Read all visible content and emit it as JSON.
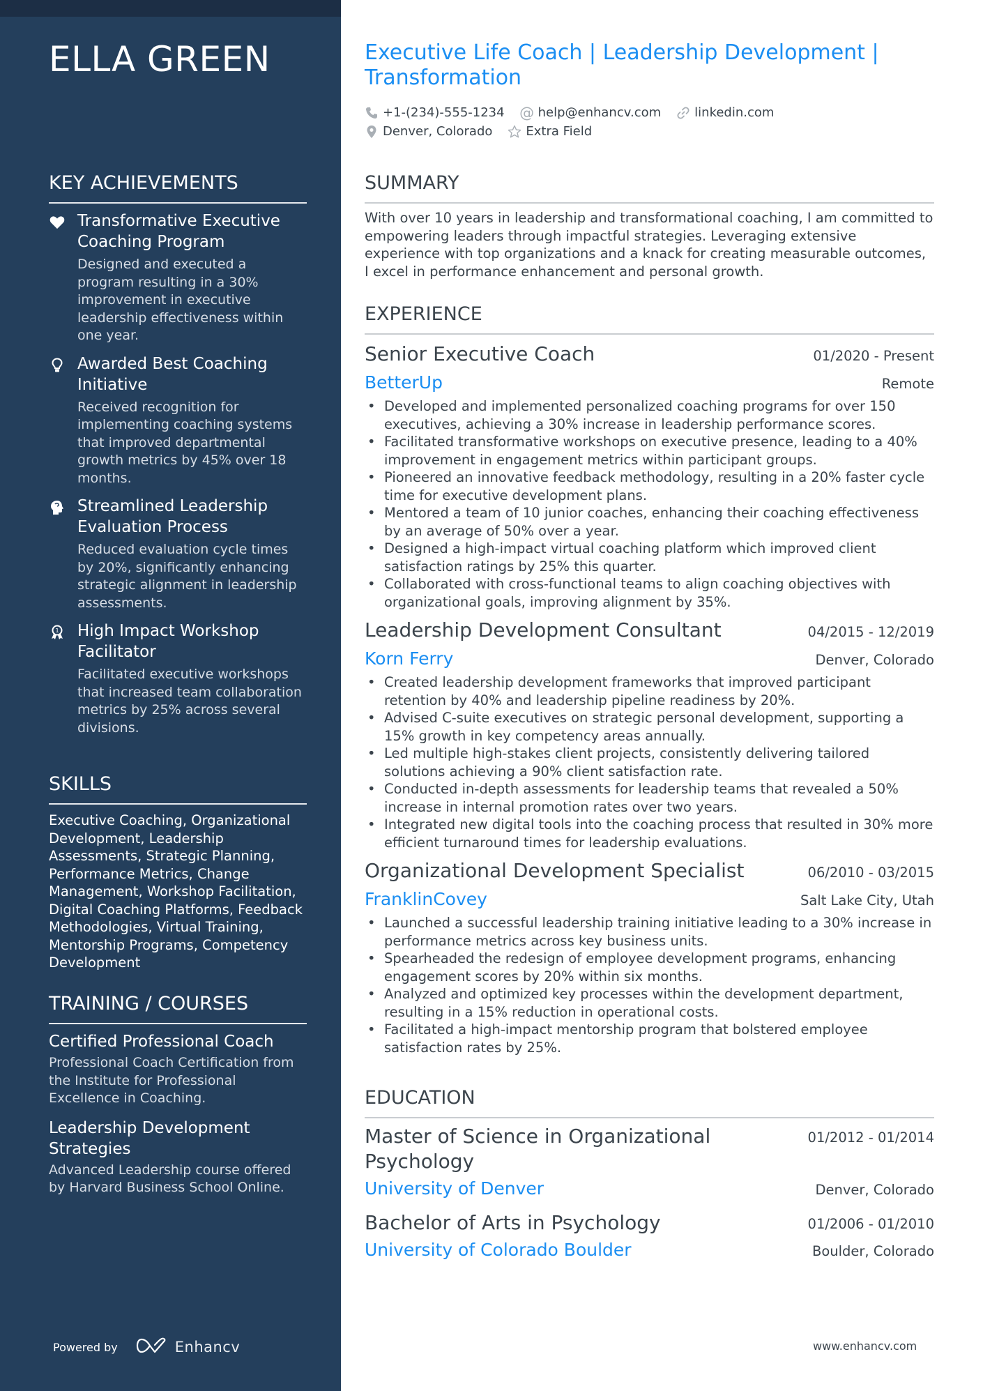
{
  "name": "ELLA GREEN",
  "headline": "Executive Life Coach | Leadership Development | Transformation",
  "contacts": {
    "phone": {
      "icon": "phone-icon",
      "text": "+1-(234)-555-1234"
    },
    "email": {
      "icon": "at-icon",
      "text": "help@enhancv.com"
    },
    "linkedin": {
      "icon": "link-icon",
      "text": "linkedin.com"
    },
    "location": {
      "icon": "location-pin-icon",
      "text": "Denver, Colorado"
    },
    "extra": {
      "icon": "star-icon",
      "text": "Extra Field"
    }
  },
  "sidebar": {
    "achievements": {
      "heading": "KEY ACHIEVEMENTS",
      "items": [
        {
          "icon": "heart-icon",
          "title": "Transformative Executive Coaching Program",
          "desc": "Designed and executed a program resulting in a 30% improvement in executive leadership effectiveness within one year."
        },
        {
          "icon": "lightbulb-icon",
          "title": "Awarded Best Coaching Initiative",
          "desc": "Received recognition for implementing coaching systems that improved departmental growth metrics by 45% over 18 months."
        },
        {
          "icon": "head-brain-icon",
          "title": "Streamlined Leadership Evaluation Process",
          "desc": "Reduced evaluation cycle times by 20%, significantly enhancing strategic alignment in leadership assessments."
        },
        {
          "icon": "award-ribbon-icon",
          "title": "High Impact Workshop Facilitator",
          "desc": "Facilitated executive workshops that increased team collaboration metrics by 25% across several divisions."
        }
      ]
    },
    "skills": {
      "heading": "SKILLS",
      "text": "Executive Coaching, Organizational Development, Leadership Assessments, Strategic Planning, Performance Metrics, Change Management, Workshop Facilitation, Digital Coaching Platforms, Feedback Methodologies, Virtual Training, Mentorship Programs, Competency Development"
    },
    "training": {
      "heading": "TRAINING / COURSES",
      "items": [
        {
          "title": "Certified Professional Coach",
          "desc": "Professional Coach Certification from the Institute for Professional Excellence in Coaching."
        },
        {
          "title": "Leadership Development Strategies",
          "desc": "Advanced Leadership course offered by Harvard Business School Online."
        }
      ]
    },
    "powered_by": "Powered by",
    "brand": "Enhancv"
  },
  "summary": {
    "heading": "SUMMARY",
    "text": "With over 10 years in leadership and transformational coaching, I am committed to empowering leaders through impactful strategies. Leveraging extensive experience with top organizations and a knack for creating measurable outcomes, I excel in performance enhancement and personal growth."
  },
  "experience": {
    "heading": "EXPERIENCE",
    "jobs": [
      {
        "title": "Senior Executive Coach",
        "dates": "01/2020 - Present",
        "company": "BetterUp",
        "location": "Remote",
        "bullets": [
          "Developed and implemented personalized coaching programs for over 150 executives, achieving a 30% increase in leadership performance scores.",
          "Facilitated transformative workshops on executive presence, leading to a 40% improvement in engagement metrics within participant groups.",
          "Pioneered an innovative feedback methodology, resulting in a 20% faster cycle time for executive development plans.",
          "Mentored a team of 10 junior coaches, enhancing their coaching effectiveness by an average of 50% over a year.",
          "Designed a high-impact virtual coaching platform which improved client satisfaction ratings by 25% this quarter.",
          "Collaborated with cross-functional teams to align coaching objectives with organizational goals, improving alignment by 35%."
        ]
      },
      {
        "title": "Leadership Development Consultant",
        "dates": "04/2015 - 12/2019",
        "company": "Korn Ferry",
        "location": "Denver, Colorado",
        "bullets": [
          "Created leadership development frameworks that improved participant retention by 40% and leadership pipeline readiness by 20%.",
          "Advised C-suite executives on strategic personal development, supporting a 15% growth in key competency areas annually.",
          "Led multiple high-stakes client projects, consistently delivering tailored solutions achieving a 90% client satisfaction rate.",
          "Conducted in-depth assessments for leadership teams that revealed a 50% increase in internal promotion rates over two years.",
          "Integrated new digital tools into the coaching process that resulted in 30% more efficient turnaround times for leadership evaluations."
        ]
      },
      {
        "title": "Organizational Development Specialist",
        "dates": "06/2010 - 03/2015",
        "company": "FranklinCovey",
        "location": "Salt Lake City, Utah",
        "bullets": [
          "Launched a successful leadership training initiative leading to a 30% increase in performance metrics across key business units.",
          "Spearheaded the redesign of employee development programs, enhancing engagement scores by 20% within six months.",
          "Analyzed and optimized key processes within the development department, resulting in a 15% reduction in operational costs.",
          "Facilitated a high-impact mentorship program that bolstered employee satisfaction rates by 25%."
        ]
      }
    ]
  },
  "education": {
    "heading": "EDUCATION",
    "items": [
      {
        "degree": "Master of Science in Organizational Psychology",
        "dates": "01/2012 - 01/2014",
        "school": "University of Denver",
        "location": "Denver, Colorado"
      },
      {
        "degree": "Bachelor of Arts in Psychology",
        "dates": "01/2006 - 01/2010",
        "school": "University of Colorado Boulder",
        "location": "Boulder, Colorado"
      }
    ]
  },
  "footer_url": "www.enhancv.com",
  "colors": {
    "sidebar": "#243f5c",
    "sidebar_top": "#1c2e45",
    "accent": "#1b8ef2",
    "text": "#3b444c"
  }
}
